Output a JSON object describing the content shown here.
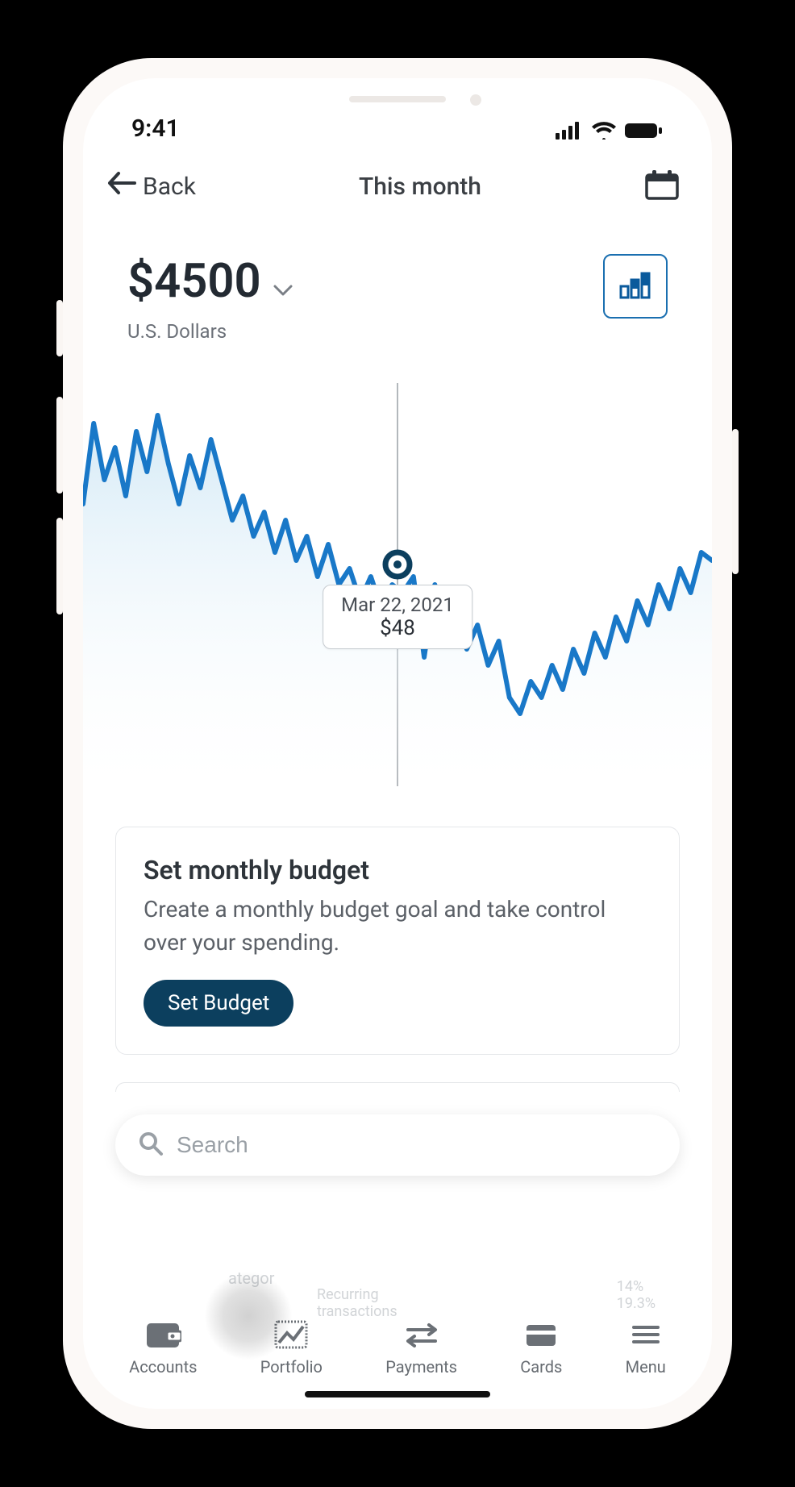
{
  "status": {
    "time": "9:41"
  },
  "header": {
    "back_label": "Back",
    "title": "This month"
  },
  "balance": {
    "amount": "$4500",
    "currency": "U.S. Dollars"
  },
  "chart_tooltip": {
    "date": "Mar 22, 2021",
    "value": "$48"
  },
  "budget_card": {
    "title": "Set monthly budget",
    "description": "Create a monthly budget goal and take control over your spending.",
    "button": "Set Budget"
  },
  "search": {
    "placeholder": "Search"
  },
  "nav": {
    "accounts": "Accounts",
    "portfolio": "Portfolio",
    "payments": "Payments",
    "cards": "Cards",
    "menu": "Menu"
  },
  "chart_data": {
    "type": "line",
    "title": "",
    "xlabel": "",
    "ylabel": "",
    "ylim": [
      0,
      100
    ],
    "highlight": {
      "index": 30,
      "label": "Mar 22, 2021",
      "value": 48
    },
    "series": [
      {
        "name": "balance",
        "values": [
          70,
          90,
          76,
          84,
          72,
          88,
          78,
          92,
          80,
          70,
          82,
          74,
          86,
          76,
          66,
          72,
          62,
          68,
          58,
          66,
          56,
          62,
          52,
          60,
          50,
          54,
          46,
          52,
          44,
          50,
          48,
          52,
          32,
          50,
          40,
          44,
          34,
          40,
          30,
          36,
          22,
          18,
          26,
          22,
          30,
          24,
          34,
          28,
          38,
          32,
          42,
          36,
          46,
          40,
          50,
          44,
          54,
          48,
          58,
          56
        ]
      }
    ]
  }
}
